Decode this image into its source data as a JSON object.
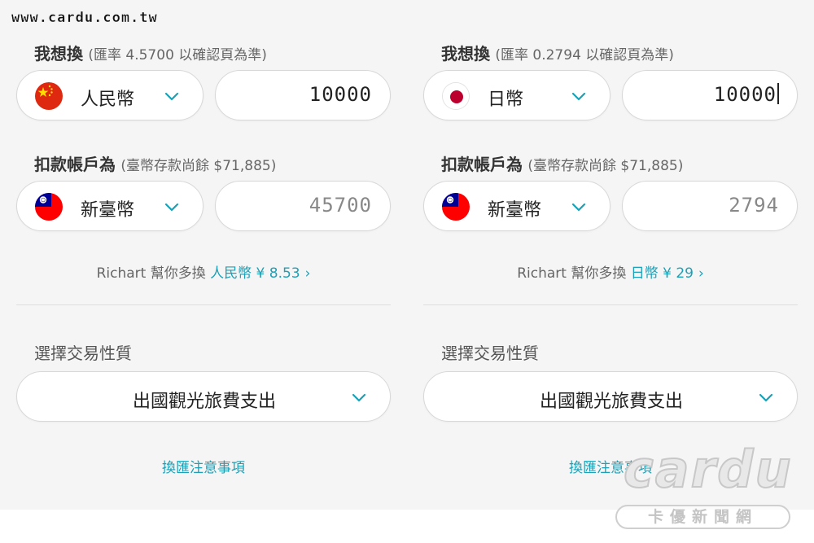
{
  "site_url": "www.cardu.com.tw",
  "panels": [
    {
      "want_label": "我想換",
      "want_rate_note": "(匯率 4.5700 以確認頁為準)",
      "want_currency": {
        "name": "人民幣",
        "flag": "china-flag"
      },
      "want_amount": "10000",
      "debit_label": "扣款帳戶為",
      "debit_note": "(臺幣存款尚餘 $71,885)",
      "debit_currency": {
        "name": "新臺幣",
        "flag": "taiwan-flag"
      },
      "debit_amount": "45700",
      "richart_prefix": "Richart 幫你多換",
      "richart_bonus": "人民幣 ¥ 8.53",
      "richart_arrow": "›",
      "purpose_label": "選擇交易性質",
      "purpose_value": "出國觀光旅費支出",
      "notice_link": "換匯注意事項"
    },
    {
      "want_label": "我想換",
      "want_rate_note": "(匯率 0.2794 以確認頁為準)",
      "want_currency": {
        "name": "日幣",
        "flag": "japan-flag"
      },
      "want_amount": "10000",
      "debit_label": "扣款帳戶為",
      "debit_note": "(臺幣存款尚餘 $71,885)",
      "debit_currency": {
        "name": "新臺幣",
        "flag": "taiwan-flag"
      },
      "debit_amount": "2794",
      "richart_prefix": "Richart 幫你多換",
      "richart_bonus": "日幣 ¥ 29",
      "richart_arrow": "›",
      "purpose_label": "選擇交易性質",
      "purpose_value": "出國觀光旅費支出",
      "notice_link": "換匯注意事項"
    }
  ],
  "watermark": {
    "brand": "cardu",
    "subtitle": "卡優新聞網"
  },
  "colors": {
    "accent": "#1aa1b8",
    "background": "#f5f5f5",
    "pill_border": "#d8d8d8"
  }
}
